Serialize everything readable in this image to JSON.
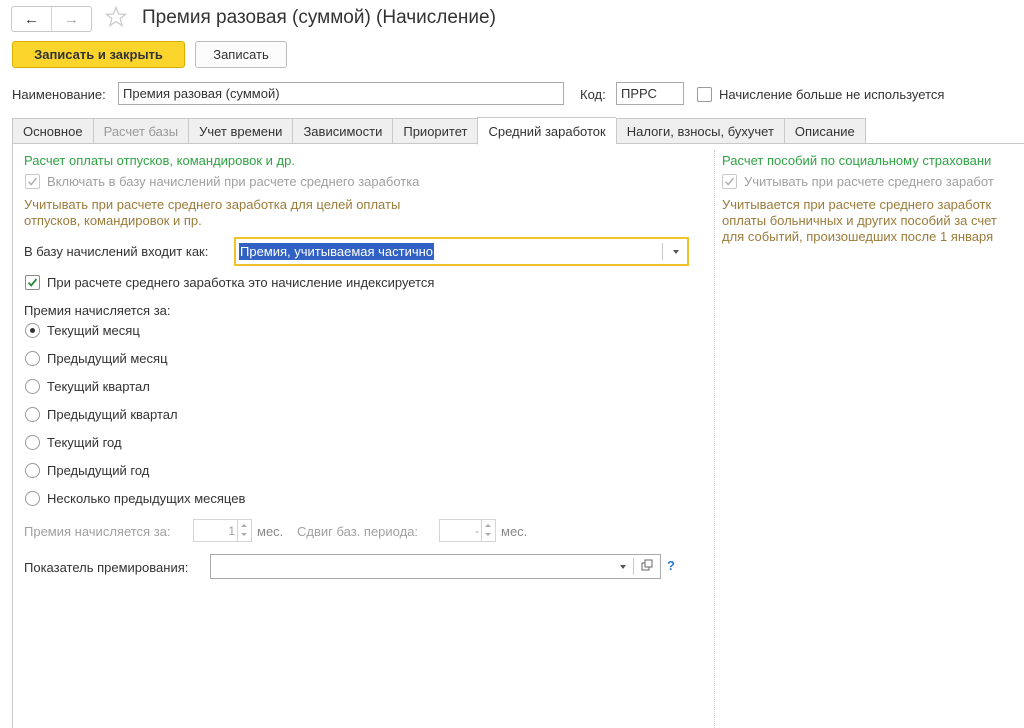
{
  "window": {
    "title": "Премия разовая (суммой) (Начисление)",
    "back_icon": "arrow-left-icon",
    "forward_icon": "arrow-right-icon",
    "favorite_icon": "star-icon"
  },
  "toolbar": {
    "save_close_label": "Записать и закрыть",
    "save_label": "Записать"
  },
  "header": {
    "name_label": "Наименование:",
    "name_value": "Премия разовая (суммой)",
    "code_label": "Код:",
    "code_value": "ПРРС",
    "not_used_label": "Начисление больше не используется",
    "not_used_checked": false
  },
  "tabs": [
    {
      "label": "Основное",
      "state": "normal"
    },
    {
      "label": "Расчет базы",
      "state": "disabled"
    },
    {
      "label": "Учет времени",
      "state": "normal"
    },
    {
      "label": "Зависимости",
      "state": "normal"
    },
    {
      "label": "Приоритет",
      "state": "normal"
    },
    {
      "label": "Средний заработок",
      "state": "active"
    },
    {
      "label": "Налоги, взносы, бухучет",
      "state": "normal"
    },
    {
      "label": "Описание",
      "state": "normal"
    }
  ],
  "left": {
    "section_title": "Расчет оплаты отпусков, командировок и др.",
    "include_label": "Включать в базу начислений при расчете среднего заработка",
    "include_checked": true,
    "hint_line1": "Учитывать при расчете среднего заработка для целей оплаты",
    "hint_line2": "отпусков, командировок и пр.",
    "base_label": "В базу начислений входит как:",
    "base_value": "Премия, учитываемая частично",
    "indexed_label": "При расчете среднего заработка это начисление индексируется",
    "indexed_checked": true,
    "period_title": "Премия начисляется за:",
    "period_options": [
      {
        "label": "Текущий месяц",
        "selected": true
      },
      {
        "label": "Предыдущий месяц",
        "selected": false
      },
      {
        "label": "Текущий квартал",
        "selected": false
      },
      {
        "label": "Предыдущий квартал",
        "selected": false
      },
      {
        "label": "Текущий год",
        "selected": false
      },
      {
        "label": "Предыдущий год",
        "selected": false
      },
      {
        "label": "Несколько предыдущих месяцев",
        "selected": false
      }
    ],
    "months_label": "Премия начисляется за:",
    "months_value": "1",
    "months_unit": "мес.",
    "shift_label": "Сдвиг баз. периода:",
    "shift_value": "-",
    "shift_unit": "мес.",
    "indicator_label": "Показатель премирования:",
    "indicator_value": "",
    "help_label": "?"
  },
  "right": {
    "section_title": "Расчет пособий по социальному страховани",
    "include_label": "Учитывать при расчете среднего заработ",
    "include_checked": true,
    "hint_line1": "Учитывается при расчете среднего заработк",
    "hint_line2": "оплаты больничных и других пособий за счет",
    "hint_line3": "для событий, произошедших после 1 января"
  },
  "colors": {
    "primary_button": "#fbd52c",
    "section_title": "#2fa344",
    "hint": "#9a7c3a",
    "selection": "#3161c4",
    "active_field_border": "#f2c12e",
    "help": "#2a7bd4"
  }
}
